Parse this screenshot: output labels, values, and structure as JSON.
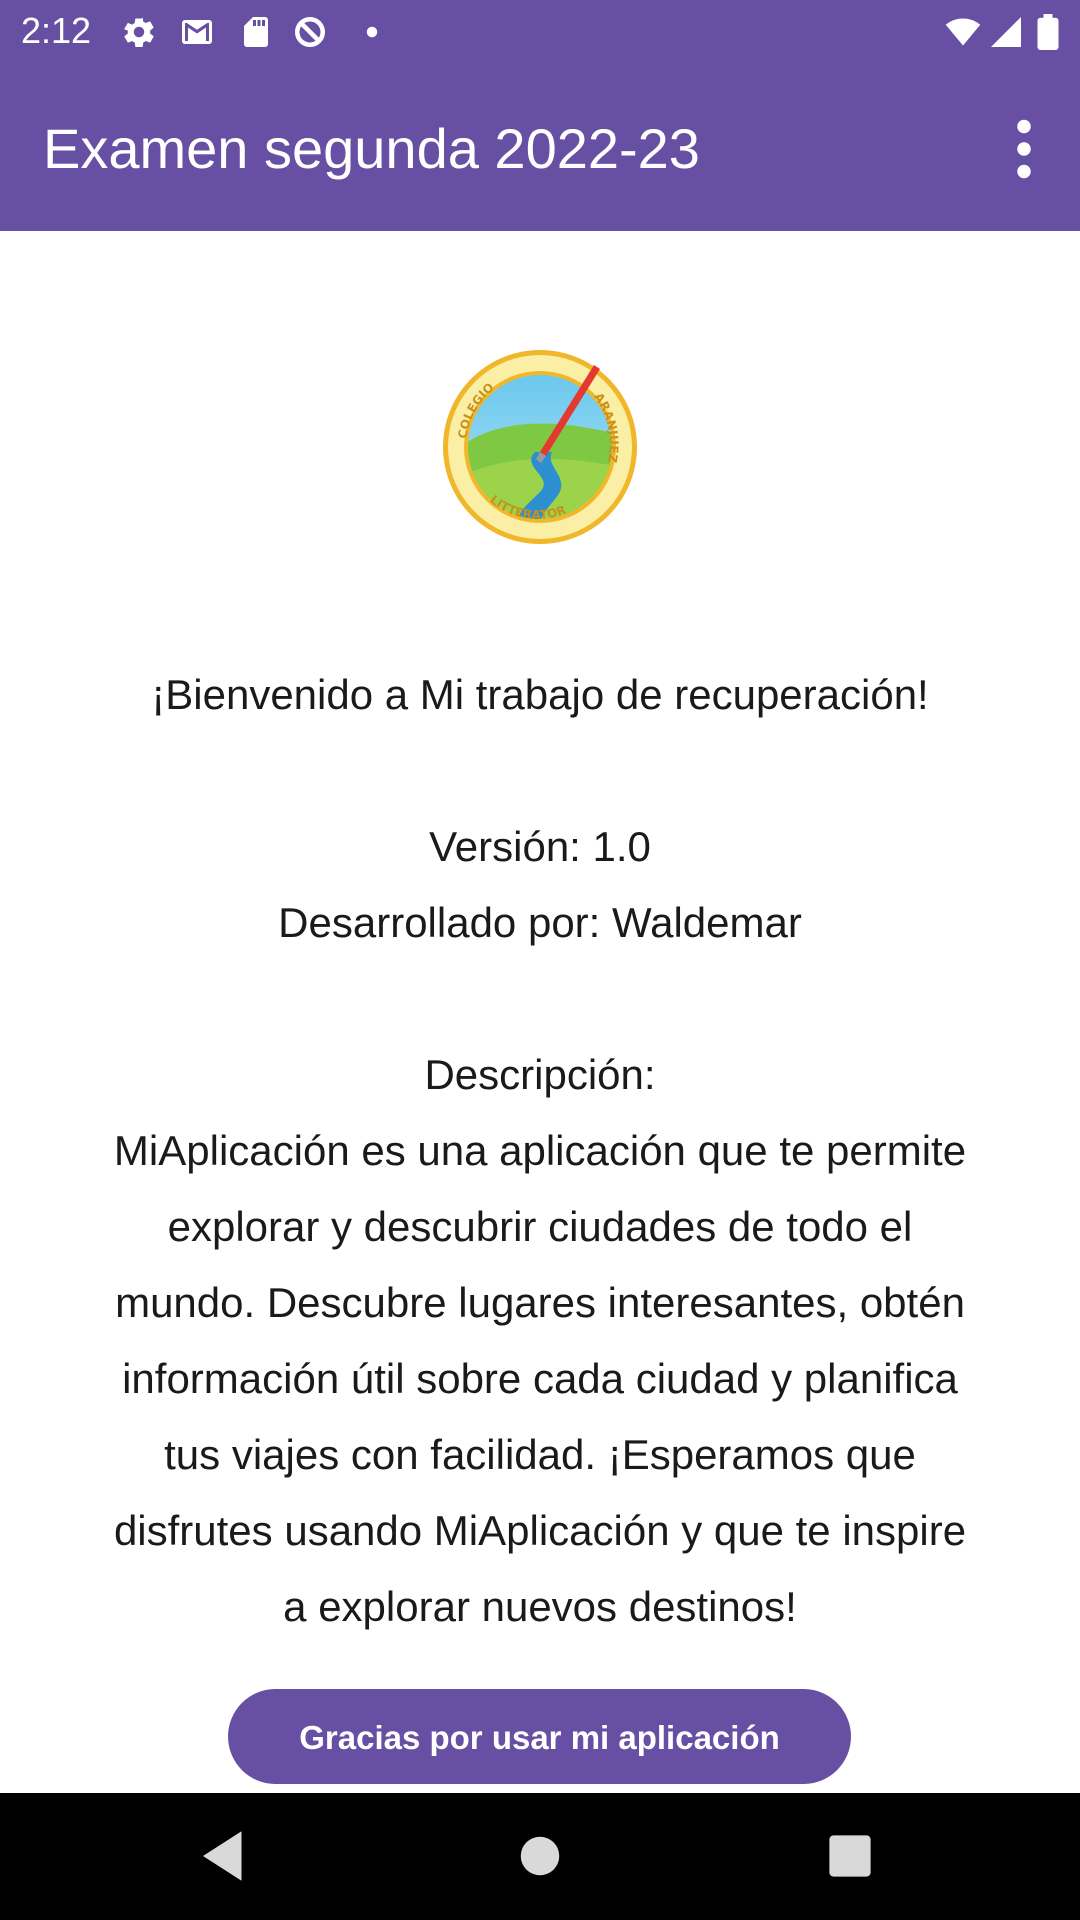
{
  "status_bar": {
    "time": "2:12",
    "left_icons": [
      "settings-icon",
      "gmail-icon",
      "sd-card-icon",
      "data-saver-icon",
      "notification-dot-icon"
    ],
    "right_icons": [
      "wifi-icon",
      "cellular-signal-icon",
      "battery-icon"
    ]
  },
  "app_bar": {
    "title": "Examen segunda 2022-23",
    "menu_icon": "more-vertical-icon"
  },
  "logo": {
    "name": "colegio-litterator-aranjuez-logo",
    "text_top": "COLEGIO",
    "text_bottom": "LITTERATOR",
    "text_right": "ARANJUEZ"
  },
  "content": {
    "welcome": "¡Bienvenido a Mi trabajo de recuperación!",
    "version": "Versión: 1.0",
    "developer": "Desarrollado por: Waldemar",
    "description_label": "Descripción:",
    "description_lines": [
      "MiAplicación es una aplicación que te permite",
      "explorar y descubrir ciudades de todo el",
      "mundo. Descubre lugares interesantes, obtén",
      "información útil sobre cada ciudad y planifica",
      "tus viajes con facilidad. ¡Esperamos que",
      "disfrutes usando MiAplicación y que te inspire",
      "a explorar nuevos destinos!"
    ]
  },
  "button": {
    "label": "Gracias por usar mi aplicación"
  },
  "nav_bar": {
    "back_icon": "back-triangle-icon",
    "home_icon": "home-circle-icon",
    "recents_icon": "recents-square-icon"
  },
  "colors": {
    "primary": "#6750A4",
    "on_primary": "#FFFFFF",
    "text": "#1A1A1A",
    "nav_bar": "#000000"
  }
}
